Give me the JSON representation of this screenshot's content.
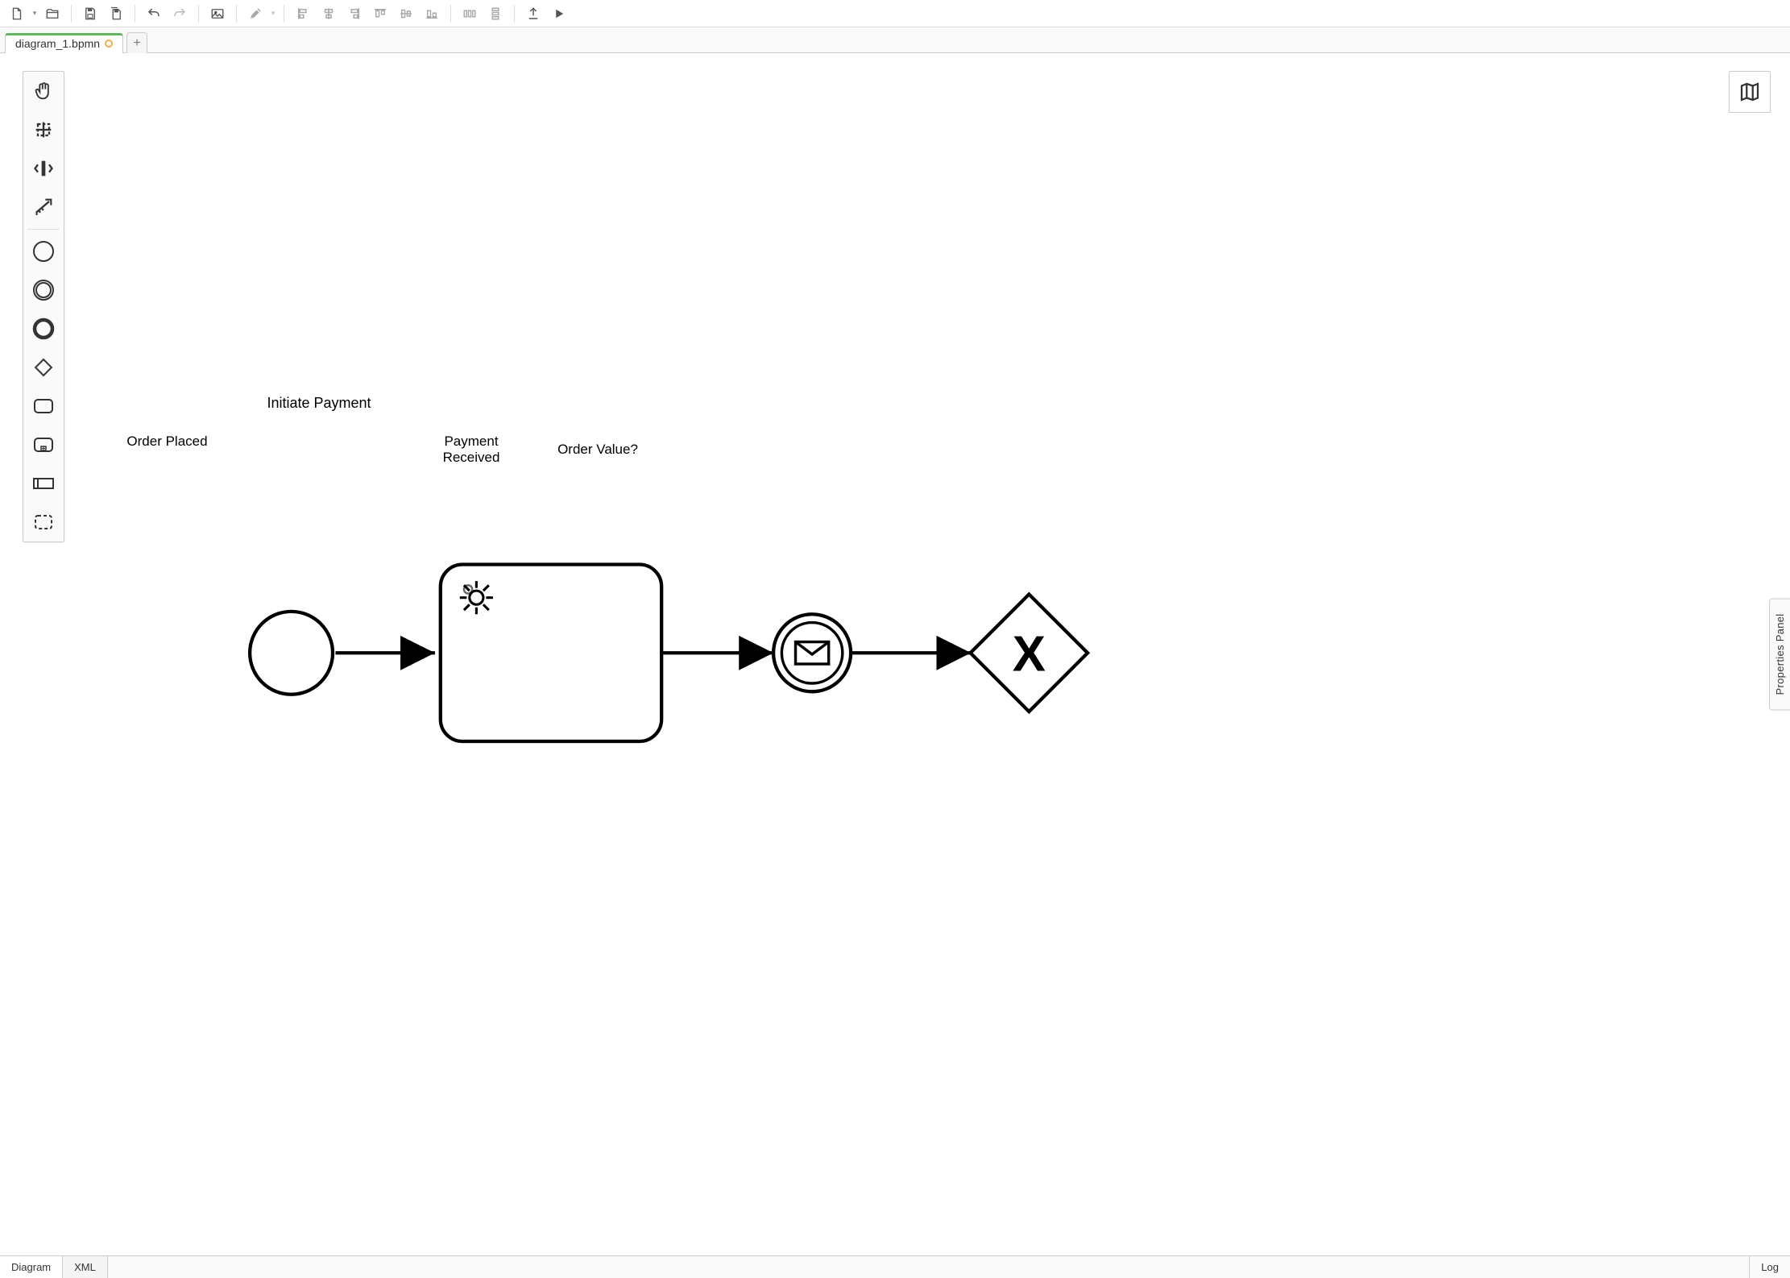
{
  "tabs": {
    "active": {
      "label": "diagram_1.bpmn",
      "dirty": true
    }
  },
  "bottombar": {
    "diagram": "Diagram",
    "xml": "XML",
    "log": "Log"
  },
  "props_panel": {
    "label": "Properties Panel"
  },
  "diagram": {
    "start_event": {
      "label": "Order Placed"
    },
    "task_1": {
      "label": "Initiate Payment"
    },
    "intermediate_event": {
      "label": "Payment\nReceived"
    },
    "gateway": {
      "label": "Order Value?"
    }
  }
}
